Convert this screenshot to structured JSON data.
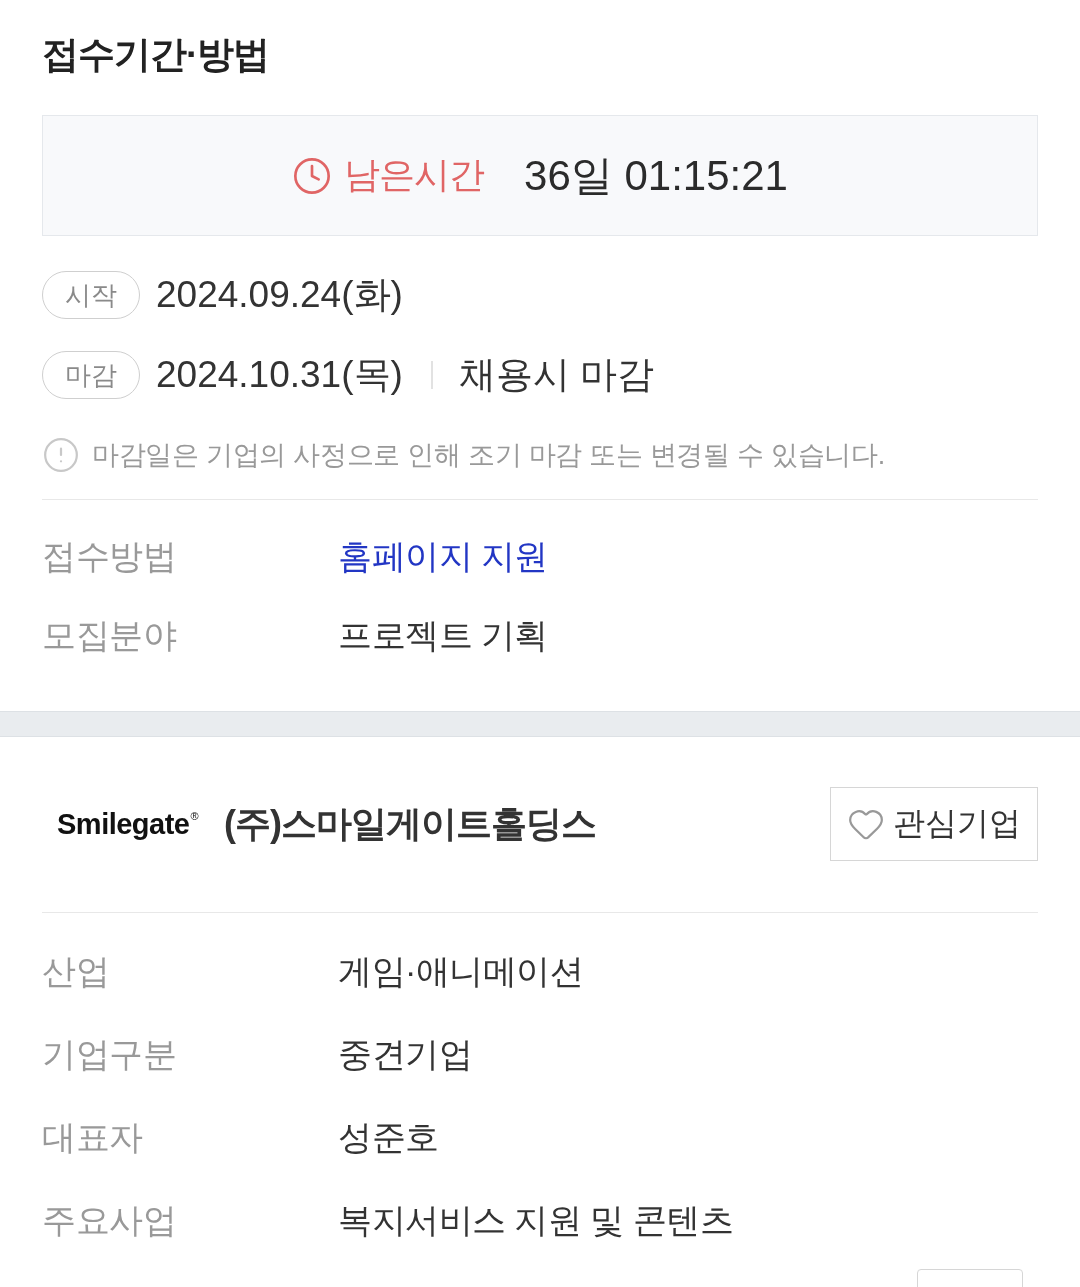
{
  "section": {
    "title": "접수기간·방법"
  },
  "countdown": {
    "label": "남은시간",
    "value": "36일 01:15:21"
  },
  "dates": [
    {
      "tag": "시작",
      "date": "2024.09.24(화)"
    },
    {
      "tag": "마감",
      "date": "2024.10.31(목)",
      "note": "채용시 마감"
    }
  ],
  "notice": "마감일은 기업의 사정으로 인해 조기 마감 또는 변경될 수 있습니다.",
  "apply_info": [
    {
      "label": "접수방법",
      "value": "홈페이지 지원",
      "kind": "link"
    },
    {
      "label": "모집분야",
      "value": "프로젝트 기획",
      "kind": "text"
    }
  ],
  "company": {
    "logo": "Smilegate$^{®}$",
    "name": "(주)스마일게이트홀딩스",
    "follow_button": {
      "label": "관심기업",
      "followed": false
    },
    "details": [
      {
        "label": "산업",
        "value": "게임·애니메이션"
      },
      {
        "label": "기업구분",
        "value": "중견기업"
      },
      {
        "label": "대표자",
        "value": "성준호"
      },
      {
        "label": "주요사업",
        "value": "복지서비스 지원 및 콘텐츠"
      }
    ]
  }
}
